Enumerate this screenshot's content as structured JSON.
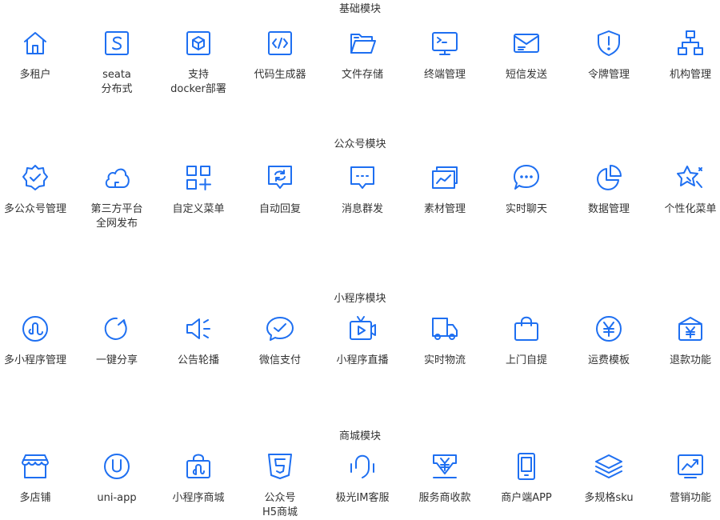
{
  "sections": [
    {
      "title": "基础模块",
      "items": [
        {
          "label": "多租户",
          "icon": "home-icon"
        },
        {
          "label": "seata\n分布式",
          "icon": "seata-s-icon"
        },
        {
          "label": "支持\ndocker部署",
          "icon": "docker-box-icon"
        },
        {
          "label": "代码生成器",
          "icon": "code-icon"
        },
        {
          "label": "文件存储",
          "icon": "folder-icon"
        },
        {
          "label": "终端管理",
          "icon": "terminal-icon"
        },
        {
          "label": "短信发送",
          "icon": "sms-icon"
        },
        {
          "label": "令牌管理",
          "icon": "shield-alert-icon"
        },
        {
          "label": "机构管理",
          "icon": "org-chart-icon"
        }
      ]
    },
    {
      "title": "公众号模块",
      "items": [
        {
          "label": "多公众号管理",
          "icon": "verified-badge-icon"
        },
        {
          "label": "第三方平台\n全网发布",
          "icon": "cloud-icon"
        },
        {
          "label": "自定义菜单",
          "icon": "grid-add-icon"
        },
        {
          "label": "自动回复",
          "icon": "auto-reply-icon"
        },
        {
          "label": "消息群发",
          "icon": "message-dots-icon"
        },
        {
          "label": "素材管理",
          "icon": "gallery-chart-icon"
        },
        {
          "label": "实时聊天",
          "icon": "chat-bubble-icon"
        },
        {
          "label": "数据管理",
          "icon": "pie-chart-icon"
        },
        {
          "label": "个性化菜单",
          "icon": "star-sparkle-icon"
        }
      ]
    },
    {
      "title": "小程序模块",
      "items": [
        {
          "label": "多小程序管理",
          "icon": "mini-program-icon"
        },
        {
          "label": "一键分享",
          "icon": "share-refresh-icon"
        },
        {
          "label": "公告轮播",
          "icon": "speaker-icon"
        },
        {
          "label": "微信支付",
          "icon": "wechat-pay-icon"
        },
        {
          "label": "小程序直播",
          "icon": "live-tv-icon"
        },
        {
          "label": "实时物流",
          "icon": "truck-icon"
        },
        {
          "label": "上门自提",
          "icon": "shopping-bag-icon"
        },
        {
          "label": "运费模板",
          "icon": "yuan-circle-icon"
        },
        {
          "label": "退款功能",
          "icon": "refund-icon"
        }
      ]
    },
    {
      "title": "商城模块",
      "items": [
        {
          "label": "多店铺",
          "icon": "store-icon"
        },
        {
          "label": "uni-app",
          "icon": "uni-app-icon"
        },
        {
          "label": "小程序商城",
          "icon": "mini-mall-icon"
        },
        {
          "label": "公众号\nH5商城",
          "icon": "html5-icon"
        },
        {
          "label": "极光IM客服",
          "icon": "headset-icon"
        },
        {
          "label": "服务商收款",
          "icon": "yuan-download-icon"
        },
        {
          "label": "商户端APP",
          "icon": "phone-icon"
        },
        {
          "label": "多规格sku",
          "icon": "layers-icon"
        },
        {
          "label": "营销功能",
          "icon": "trend-chart-icon"
        }
      ]
    }
  ],
  "icon_color": "#1e6ff1"
}
